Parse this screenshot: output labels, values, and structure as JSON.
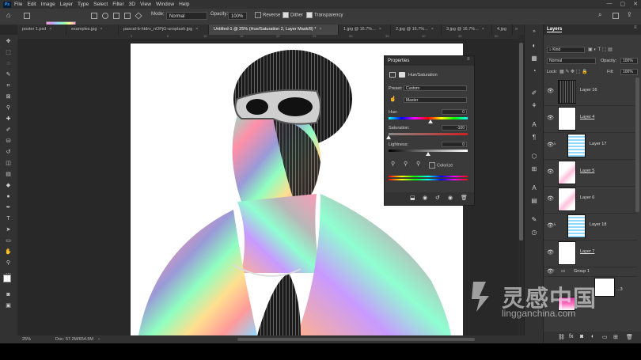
{
  "app": {
    "logo": "Ps"
  },
  "menu": [
    "File",
    "Edit",
    "Image",
    "Layer",
    "Type",
    "Select",
    "Filter",
    "3D",
    "View",
    "Window",
    "Help"
  ],
  "window_controls": {
    "minimize": "—",
    "maximize": "▢",
    "close": "✕"
  },
  "options_bar": {
    "mode_label": "Mode:",
    "mode_value": "Normal",
    "opacity_label": "Opacity:",
    "opacity_value": "100%",
    "reverse_label": "Reverse",
    "dither_label": "Dither",
    "transparency_label": "Transparency",
    "reverse_checked": false,
    "dither_checked": true,
    "transparency_checked": true
  },
  "tabs": [
    {
      "label": "poster 1.psd",
      "close": "×"
    },
    {
      "label": "examples.jpg",
      "close": "×"
    },
    {
      "label": "pascal-b-htdrv_nOPjG-unsplash.jpg",
      "close": "×"
    },
    {
      "label": "Untitled-1 @ 25% (Hue/Saturation 2, Layer Mask/8) *",
      "close": "×"
    },
    {
      "label": "1.jpg @ 16.7%...",
      "close": "×"
    },
    {
      "label": "2.jpg @ 16.7%...",
      "close": "×"
    },
    {
      "label": "3.jpg @ 16.7%...",
      "close": "×"
    },
    {
      "label": "4.jpg",
      "close": ""
    }
  ],
  "ruler": [
    "0",
    "5",
    "10",
    "15",
    "20",
    "25",
    "30",
    "35",
    "40",
    "45",
    "50"
  ],
  "status": {
    "zoom": "25%",
    "doc": "Doc: 57.2M/654.5M"
  },
  "properties": {
    "title": "Properties",
    "adjustment": "Hue/Saturation",
    "preset_label": "Preset:",
    "preset_value": "Custom",
    "channel_value": "Master",
    "hue_label": "Hue:",
    "hue_value": "0",
    "saturation_label": "Saturation:",
    "saturation_value": "-100",
    "lightness_label": "Lightness:",
    "lightness_value": "0",
    "colorize_label": "Colorize",
    "hue_level": 0.53,
    "saturation_level": 0.0,
    "lightness_level": 0.5
  },
  "layers": {
    "title": "Layers",
    "filter_value": "Kind",
    "blend_value": "Normal",
    "opacity_label": "Opacity:",
    "opacity_value": "100%",
    "lock_label": "Lock:",
    "fill_label": "Fill:",
    "fill_value": "100%",
    "items": [
      {
        "name": "Layer 16",
        "thumb": "dark"
      },
      {
        "name": "Layer 4",
        "thumb": "white"
      },
      {
        "name": "Layer 17",
        "thumb": "stripes"
      },
      {
        "name": "Layer 5",
        "thumb": "pink"
      },
      {
        "name": "Layer 6",
        "thumb": "pink"
      },
      {
        "name": "Layer 18",
        "thumb": "stripes"
      },
      {
        "name": "Layer 7",
        "thumb": "white"
      }
    ],
    "group_name": "Group 1",
    "bottom_layer_label": "...3"
  },
  "watermark": {
    "chinese": "灵感中国",
    "url": "lingganchina.com"
  },
  "colors": {
    "accent": "#31a8ff",
    "panel": "#3a3a3a",
    "canvas_bg": "#282828"
  }
}
